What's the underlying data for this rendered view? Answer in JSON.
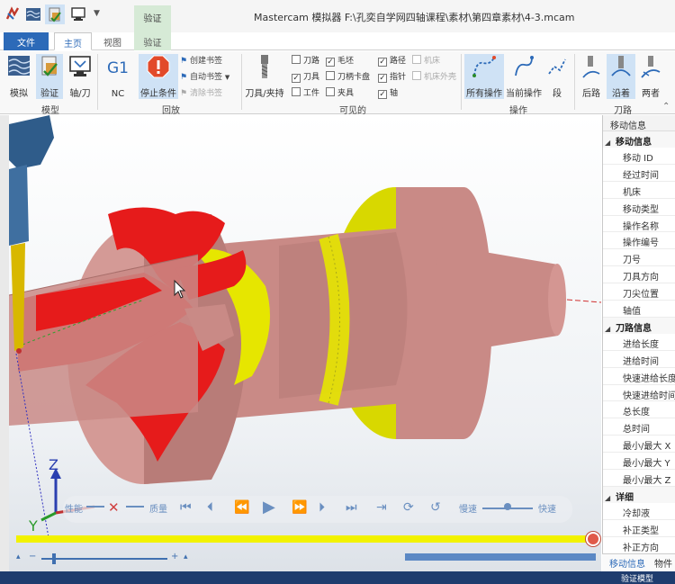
{
  "app": {
    "title": "Mastercam 模拟器  F:\\孔奕自学网四轴课程\\素材\\第四章素材\\4-3.mcam",
    "context_tab": "验证"
  },
  "tabs": {
    "file": "文件",
    "home": "主页",
    "view": "视图",
    "verify": "验证"
  },
  "ribbon": {
    "groups": {
      "model": "模型",
      "playback": "回放",
      "visible": "可见的",
      "operation": "操作",
      "toolpath": "刀路"
    },
    "buttons": {
      "simulate": "模拟",
      "verify": "验证",
      "backplot": "轴/刀",
      "nc": "NC",
      "stop_condition": "停止条件",
      "tool_holder": "刀具/夹持",
      "all_ops": "所有操作",
      "current_op": "当前操作",
      "segment": "段",
      "tip_end": "后路",
      "cut": "沿着",
      "face": "两者"
    },
    "small": {
      "create_bookmark": "创建书签",
      "auto_bookmark": "自动书签",
      "clear_bookmark": "清除书签"
    },
    "checks": [
      {
        "label": "刀路",
        "checked": false,
        "enabled": true
      },
      {
        "label": "毛坯",
        "checked": true,
        "enabled": true
      },
      {
        "label": "路径",
        "checked": true,
        "enabled": true
      },
      {
        "label": "机床",
        "checked": false,
        "enabled": false
      },
      {
        "label": "刀具",
        "checked": true,
        "enabled": true
      },
      {
        "label": "刀柄卡盘",
        "checked": false,
        "enabled": true
      },
      {
        "label": "指针",
        "checked": true,
        "enabled": true
      },
      {
        "label": "机床外壳",
        "checked": false,
        "enabled": false
      },
      {
        "label": "工件",
        "checked": false,
        "enabled": true
      },
      {
        "label": "夹具",
        "checked": false,
        "enabled": true
      },
      {
        "label": "轴",
        "checked": true,
        "enabled": true
      }
    ]
  },
  "playback": {
    "performance": "性能",
    "quality": "质量",
    "slower": "慢速",
    "faster": "快速"
  },
  "zoom": {
    "minus": "−",
    "plus": "+"
  },
  "axes": {
    "z": "Z",
    "y": "Y"
  },
  "right_panel": {
    "title": "移动信息",
    "sections": [
      {
        "label": "移动信息",
        "items": [
          "移动 ID",
          "经过时间",
          "机床",
          "移动类型",
          "操作名称",
          "操作编号",
          "刀号",
          "刀具方向",
          "刀尖位置",
          "轴值"
        ]
      },
      {
        "label": "刀路信息",
        "items": [
          "进给长度",
          "进给时间",
          "快速进给长度",
          "快速进给时间",
          "总长度",
          "总时间",
          "最小/最大 X",
          "最小/最大 Y",
          "最小/最大 Z"
        ]
      },
      {
        "label": "详细",
        "items": [
          "冷却液",
          "补正类型",
          "补正方向"
        ]
      }
    ],
    "tabs": [
      "移动信息",
      "物件"
    ]
  },
  "status": {
    "text": "验证模型"
  },
  "colors": {
    "accent": "#2c6ab8",
    "stock": "#d08a84",
    "cut_red": "#e61b1b",
    "cut_yellow": "#e6e600",
    "progress": "#f2f200"
  }
}
